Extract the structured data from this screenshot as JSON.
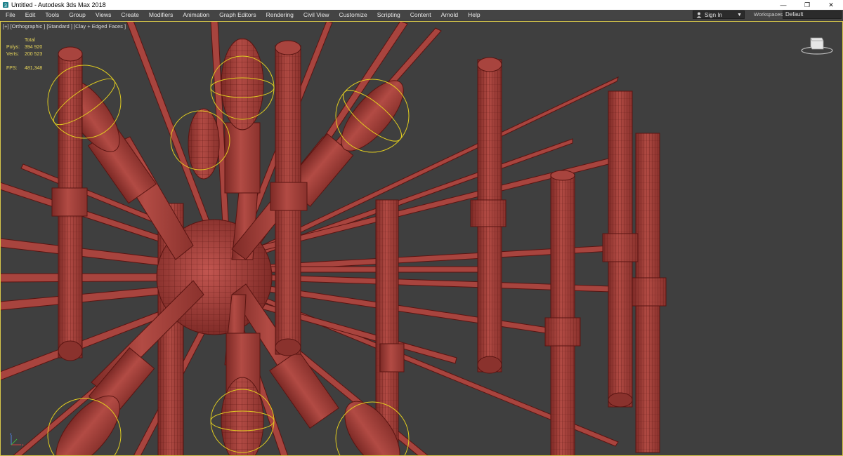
{
  "window": {
    "title": "Untitled - Autodesk 3ds Max 2018",
    "controls": [
      "—",
      "❐",
      "✕"
    ]
  },
  "menu": [
    "File",
    "Edit",
    "Tools",
    "Group",
    "Views",
    "Create",
    "Modifiers",
    "Animation",
    "Graph Editors",
    "Rendering",
    "Civil View",
    "Customize",
    "Scripting",
    "Content",
    "Arnold",
    "Help"
  ],
  "account": {
    "sign_in": "Sign In",
    "user_icon": "user-icon"
  },
  "workspaces": {
    "label": "Workspaces:",
    "value": "Default"
  },
  "viewport": {
    "label": "[+] [Orthographic ] [Standard ] [Clay + Edged Faces ]",
    "stats": {
      "header": "Total",
      "polys_label": "Polys:",
      "polys": "394 920",
      "verts_label": "Verts:",
      "verts": "200 523",
      "fps_label": "FPS:",
      "fps": "481,348"
    },
    "colors": {
      "background": "#3f3f3f",
      "clay": "#b24b44",
      "edge": "#5a1512",
      "selection_gizmo": "#e0cc20",
      "frame": "#d9c84a"
    }
  }
}
